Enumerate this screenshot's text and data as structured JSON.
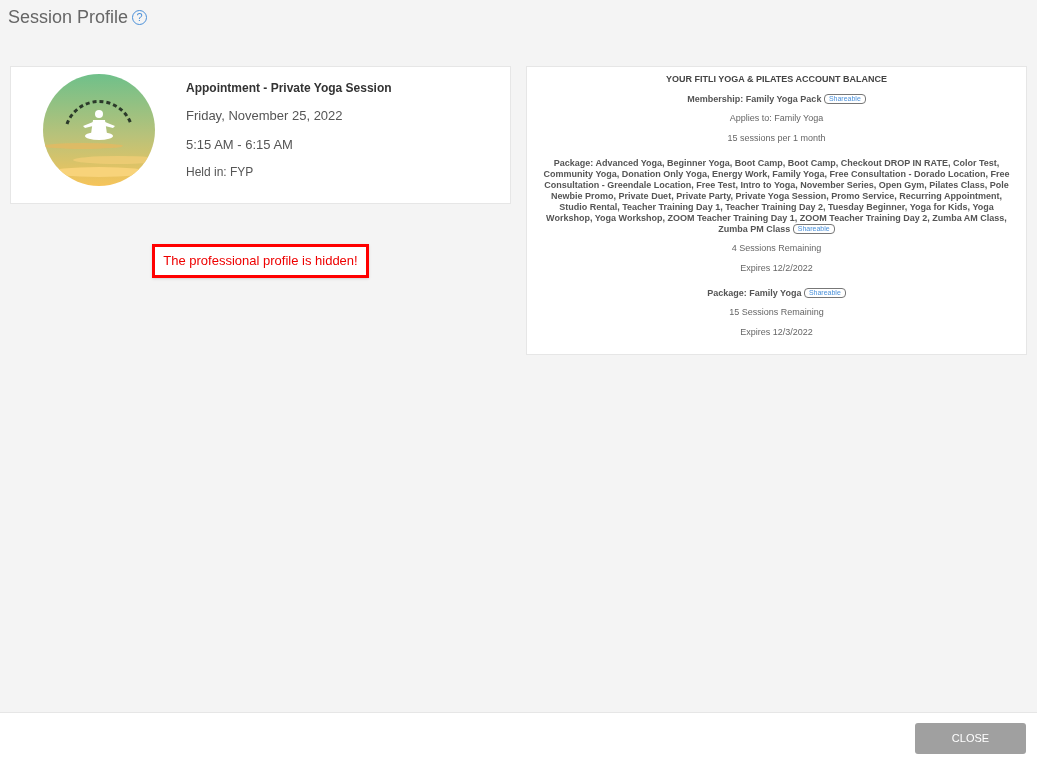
{
  "dialog": {
    "title": "Session Profile",
    "help_icon": "?"
  },
  "appointment": {
    "title": "Appointment - Private Yoga Session",
    "date": "Friday, November 25, 2022",
    "time": "5:15 AM - 6:15 AM",
    "location": "Held in: FYP"
  },
  "notice": "The professional profile is hidden!",
  "balance": {
    "heading": "YOUR FITLI YOGA & PILATES ACCOUNT BALANCE",
    "items": [
      {
        "name": "Membership: Family Yoga Pack",
        "badge": "Shareable",
        "details": [
          "Applies to: Family Yoga",
          "15 sessions per 1 month"
        ]
      },
      {
        "name": "Package: Advanced Yoga, Beginner Yoga, Boot Camp, Boot Camp, Checkout DROP IN RATE, Color Test, Community Yoga, Donation Only Yoga, Energy Work, Family Yoga, Free Consultation - Dorado Location, Free Consultation - Greendale Location, Free Test, Intro to Yoga, November Series, Open Gym, Pilates Class, Pole Newbie Promo, Private Duet, Private Party, Private Yoga Session, Promo Service, Recurring Appointment, Studio Rental, Teacher Training Day 1, Teacher Training Day 2, Tuesday Beginner, Yoga for Kids, Yoga Workshop, Yoga Workshop, ZOOM Teacher Training Day 1, ZOOM Teacher Training Day 2, Zumba AM Class, Zumba PM Class",
        "badge": "Shareable",
        "details": [
          "4 Sessions Remaining",
          "Expires 12/2/2022"
        ]
      },
      {
        "name": "Package: Family Yoga",
        "badge": "Shareable",
        "details": [
          "15 Sessions Remaining",
          "Expires 12/3/2022"
        ]
      }
    ]
  },
  "footer": {
    "button": "CLOSE"
  }
}
